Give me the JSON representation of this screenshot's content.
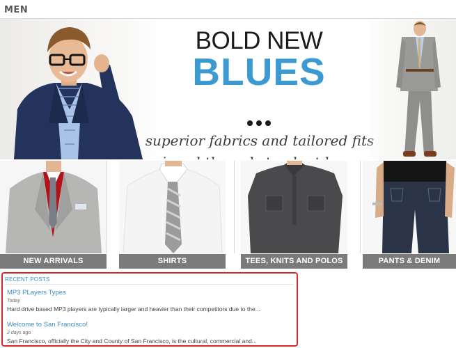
{
  "section": {
    "title": "MEN"
  },
  "hero": {
    "headline_line1": "BOLD NEW",
    "headline_line2": "BLUES",
    "tagline_line1": "superior fabrics and tailored fits",
    "tagline_line2": "in subtle and standout hues",
    "accent_color": "#3d9ad0"
  },
  "categories": [
    {
      "label": "NEW ARRIVALS"
    },
    {
      "label": "SHIRTS"
    },
    {
      "label": "TEES, KNITS AND POLOS"
    },
    {
      "label": "PANTS & DENIM"
    }
  ],
  "recent_posts": {
    "heading": "RECENT POSTS",
    "highlight_color": "#d9262a",
    "posts": [
      {
        "title": "MP3 PLayers Types",
        "date": "Today",
        "excerpt": "Hard drive based MP3 players are typically larger and heavier than their competitors due to the..."
      },
      {
        "title": "Welcome to San Francisco!",
        "date": "2 days ago",
        "excerpt": "San Francisco, officially the City and County of San Francisco, is the cultural, commercial and..."
      }
    ]
  }
}
